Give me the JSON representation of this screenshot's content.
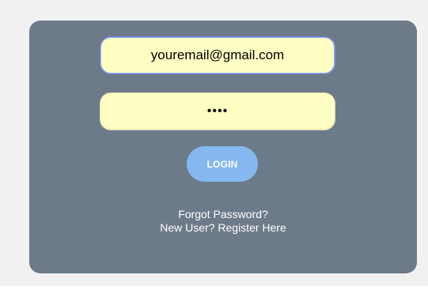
{
  "login_form": {
    "email_value": "youremail@gmail.com",
    "password_value": "••••",
    "login_label": "LOGIN",
    "forgot_password_label": "Forgot Password?",
    "register_label": "New User? Register Here"
  },
  "colors": {
    "page_background": "#f1f1f1",
    "card_background": "#6d7a89",
    "input_background": "#ffffc4",
    "button_background": "#84b8ef",
    "text_light": "#ffffff"
  }
}
